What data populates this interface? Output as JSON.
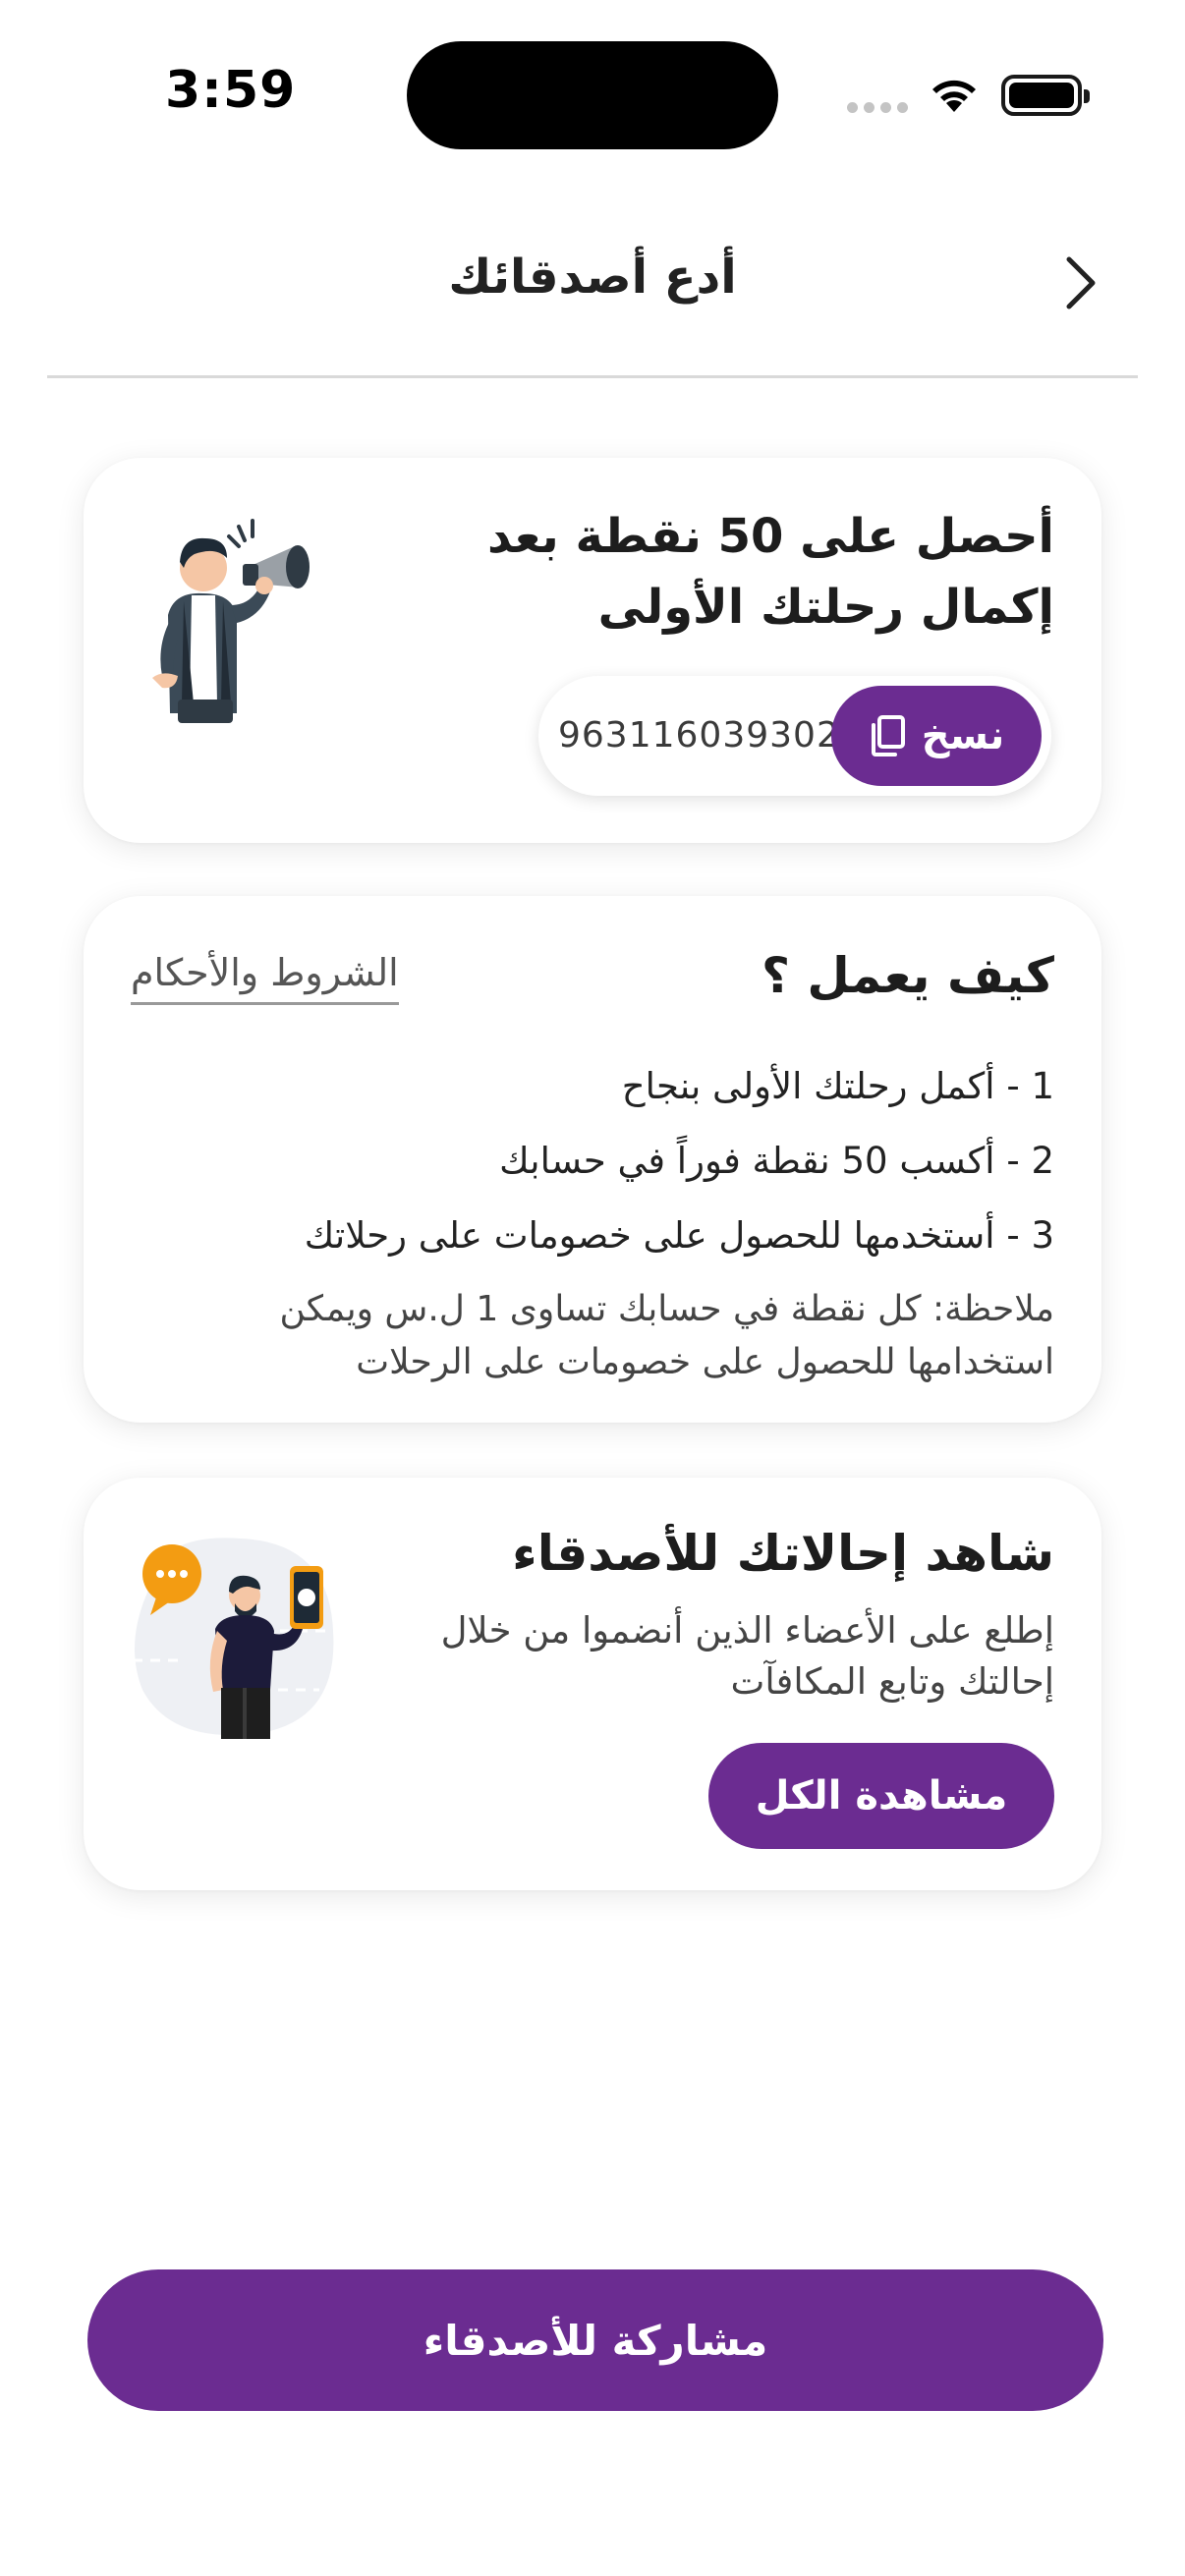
{
  "status_bar": {
    "time": "3:59"
  },
  "header": {
    "title": "أدع أصدقائك"
  },
  "referral_card": {
    "title_line1": "أحصل على 50 نقطة بعد",
    "title_line2": "إكمال رحلتك الأولى",
    "code": "963116039302",
    "copy_label": "نسخ"
  },
  "how_it_works": {
    "title": "كيف يعمل ؟",
    "terms_label": "الشروط والأحكام",
    "steps": [
      "1 - أكمل رحلتك الأولى بنجاح",
      "2 - أكسب 50 نقطة فوراً في حسابك",
      "3 - أستخدمها للحصول على خصومات على رحلاتك"
    ],
    "note": "ملاحظة: كل نقطة في حسابك تساوى 1 ل.س ويمكن استخدامها للحصول على خصومات على الرحلات"
  },
  "referrals_card": {
    "title": "شاهد إحالاتك للأصدقاء",
    "description": "إطلع على الأعضاء الذين أنضموا من خلال إحالتك وتابع المكافآت",
    "view_all_label": "مشاهدة الكل"
  },
  "share_button": {
    "label": "مشاركة للأصدقاء"
  },
  "colors": {
    "primary": "#6b2c91",
    "accent_orange": "#f39c12"
  }
}
